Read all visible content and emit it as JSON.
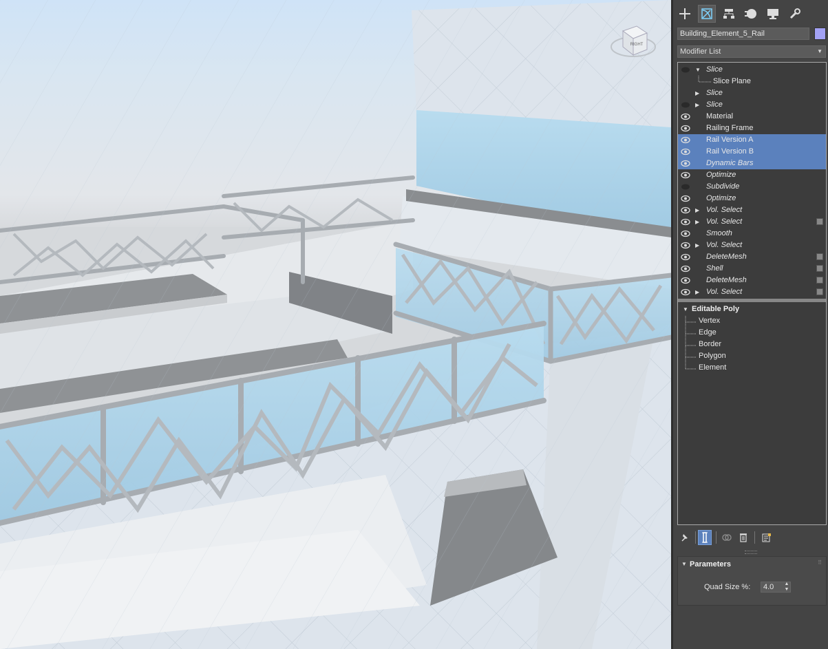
{
  "command_panel": {
    "tabs": [
      {
        "icon": "create-plus-icon",
        "active": false
      },
      {
        "icon": "modify-icon",
        "active": true
      },
      {
        "icon": "hierarchy-icon",
        "active": false
      },
      {
        "icon": "motion-icon",
        "active": false
      },
      {
        "icon": "display-icon",
        "active": false
      },
      {
        "icon": "utilities-wrench-icon",
        "active": false
      }
    ],
    "object_name": "Building_Element_5_Rail",
    "object_color": "#a3a2f5",
    "modifier_list_label": "Modifier List"
  },
  "modifier_stack": {
    "items": [
      {
        "label": "Slice",
        "italic": true,
        "eye": "off",
        "expand": "open",
        "selected": false,
        "box": false
      },
      {
        "label": "Slice Plane",
        "sub": true
      },
      {
        "label": "Slice",
        "italic": true,
        "eye": "none",
        "expand": "closed",
        "selected": false,
        "box": false
      },
      {
        "label": "Slice",
        "italic": true,
        "eye": "off",
        "expand": "closed",
        "selected": false,
        "box": false
      },
      {
        "label": "Material",
        "italic": false,
        "eye": "on",
        "expand": "",
        "selected": false,
        "box": false
      },
      {
        "label": "Railing Frame",
        "italic": false,
        "eye": "on",
        "expand": "",
        "selected": false,
        "box": false
      },
      {
        "label": "Rail Version A",
        "italic": false,
        "eye": "on",
        "expand": "",
        "selected": true,
        "box": false
      },
      {
        "label": "Rail Version B",
        "italic": false,
        "eye": "on",
        "expand": "",
        "selected": true,
        "box": false
      },
      {
        "label": "Dynamic Bars",
        "italic": true,
        "eye": "on",
        "expand": "",
        "selected": true,
        "box": false
      },
      {
        "label": "Optimize",
        "italic": true,
        "eye": "on",
        "expand": "",
        "selected": false,
        "box": false
      },
      {
        "label": "Subdivide",
        "italic": true,
        "eye": "off",
        "expand": "",
        "selected": false,
        "box": false
      },
      {
        "label": "Optimize",
        "italic": true,
        "eye": "on",
        "expand": "",
        "selected": false,
        "box": false
      },
      {
        "label": "Vol. Select",
        "italic": true,
        "eye": "on",
        "expand": "closed",
        "selected": false,
        "box": false
      },
      {
        "label": "Vol. Select",
        "italic": true,
        "eye": "on",
        "expand": "closed",
        "selected": false,
        "box": true
      },
      {
        "label": "Smooth",
        "italic": true,
        "eye": "on",
        "expand": "",
        "selected": false,
        "box": false
      },
      {
        "label": "Vol. Select",
        "italic": true,
        "eye": "on",
        "expand": "closed",
        "selected": false,
        "box": false
      },
      {
        "label": "DeleteMesh",
        "italic": true,
        "eye": "on",
        "expand": "",
        "selected": false,
        "box": true
      },
      {
        "label": "Shell",
        "italic": true,
        "eye": "on",
        "expand": "",
        "selected": false,
        "box": true
      },
      {
        "label": "DeleteMesh",
        "italic": true,
        "eye": "on",
        "expand": "",
        "selected": false,
        "box": true
      },
      {
        "label": "Vol. Select",
        "italic": true,
        "eye": "on",
        "expand": "closed",
        "selected": false,
        "box": true
      }
    ],
    "base_object": {
      "label": "Editable Poly",
      "sub_objects": [
        "Vertex",
        "Edge",
        "Border",
        "Polygon",
        "Element"
      ]
    }
  },
  "stack_toolbar": {
    "buttons": [
      {
        "icon": "pin-stack-icon",
        "active": false
      },
      {
        "icon": "show-end-result-icon",
        "active": true
      },
      {
        "icon": "make-unique-icon",
        "active": false
      },
      {
        "icon": "remove-modifier-trash-icon",
        "active": false
      },
      {
        "icon": "configure-modifier-sets-icon",
        "active": false
      }
    ]
  },
  "parameters": {
    "title": "Parameters",
    "quad_size_label": "Quad Size %:",
    "quad_size_value": "4.0"
  },
  "viewcube": {
    "face_label": "RIGHT"
  }
}
